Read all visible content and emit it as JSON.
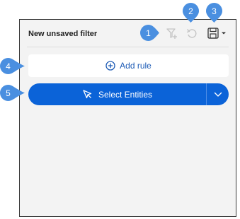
{
  "panel": {
    "title": "New unsaved filter"
  },
  "header_icons": [
    {
      "name": "add-filter-icon",
      "enabled": false
    },
    {
      "name": "undo-icon",
      "enabled": false
    },
    {
      "name": "save-icon",
      "enabled": true
    }
  ],
  "add_rule": {
    "label": "Add rule",
    "icon": "plus-circle-icon"
  },
  "select_entities": {
    "label": "Select Entities",
    "icon": "cursor-icon",
    "dropdown_icon": "chevron-down-icon"
  },
  "callouts": [
    "1",
    "2",
    "3",
    "4",
    "5"
  ],
  "colors": {
    "accent": "#0b63d8",
    "callout": "#4a8fe0",
    "link": "#1d5bb5",
    "panel_bg": "#f3f3f3",
    "disabled_icon": "#c4c4c4"
  }
}
